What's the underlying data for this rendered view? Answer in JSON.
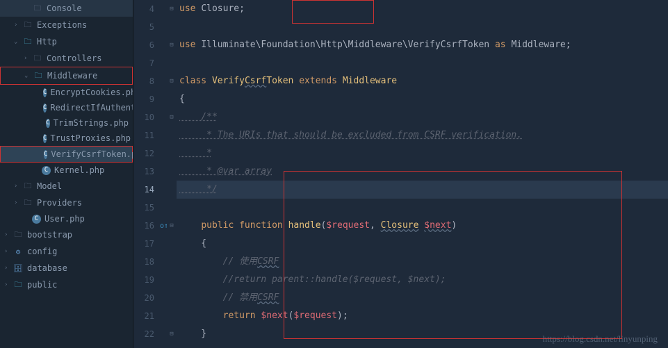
{
  "sidebar": {
    "items": [
      {
        "chevron": "",
        "icon": "folder-dark",
        "iconGlyph": "🗀",
        "label": "Console",
        "depth": 2,
        "interactable": true
      },
      {
        "chevron": "›",
        "icon": "folder-dark",
        "iconGlyph": "🗀",
        "label": "Exceptions",
        "depth": 1,
        "interactable": true
      },
      {
        "chevron": "⌄",
        "icon": "folder",
        "iconGlyph": "🗀",
        "label": "Http",
        "depth": 1,
        "interactable": true
      },
      {
        "chevron": "›",
        "icon": "folder-dark",
        "iconGlyph": "🗀",
        "label": "Controllers",
        "depth": 2,
        "interactable": true
      },
      {
        "chevron": "⌄",
        "icon": "folder",
        "iconGlyph": "🗀",
        "label": "Middleware",
        "depth": 2,
        "interactable": true,
        "redBox": 1
      },
      {
        "chevron": "",
        "icon": "php-class",
        "iconGlyph": "C",
        "label": "EncryptCookies.php",
        "depth": 4,
        "interactable": true
      },
      {
        "chevron": "",
        "icon": "php-class",
        "iconGlyph": "C",
        "label": "RedirectIfAuthenticated.php",
        "depth": 4,
        "interactable": true
      },
      {
        "chevron": "",
        "icon": "php-class",
        "iconGlyph": "C",
        "label": "TrimStrings.php",
        "depth": 4,
        "interactable": true
      },
      {
        "chevron": "",
        "icon": "php-class",
        "iconGlyph": "C",
        "label": "TrustProxies.php",
        "depth": 4,
        "interactable": true
      },
      {
        "chevron": "",
        "icon": "php-class",
        "iconGlyph": "C",
        "label": "VerifyCsrfToken.php",
        "depth": 4,
        "interactable": true,
        "selected": true,
        "redBox": 2
      },
      {
        "chevron": "",
        "icon": "php-class",
        "iconGlyph": "C",
        "label": "Kernel.php",
        "depth": 3,
        "interactable": true
      },
      {
        "chevron": "›",
        "icon": "folder-dark",
        "iconGlyph": "🗀",
        "label": "Model",
        "depth": 1,
        "interactable": true
      },
      {
        "chevron": "›",
        "icon": "folder-dark",
        "iconGlyph": "🗀",
        "label": "Providers",
        "depth": 1,
        "interactable": true
      },
      {
        "chevron": "",
        "icon": "php-class",
        "iconGlyph": "C",
        "label": "User.php",
        "depth": 2,
        "interactable": true
      },
      {
        "chevron": "›",
        "icon": "folder-dark",
        "iconGlyph": "🗀",
        "label": "bootstrap",
        "depth": 0,
        "interactable": true
      },
      {
        "chevron": "›",
        "icon": "special",
        "iconGlyph": "⚙",
        "label": "config",
        "depth": 0,
        "interactable": true
      },
      {
        "chevron": "›",
        "icon": "special",
        "iconGlyph": "🗄",
        "label": "database",
        "depth": 0,
        "interactable": true
      },
      {
        "chevron": "›",
        "icon": "folder",
        "iconGlyph": "🗀",
        "label": "public",
        "depth": 0,
        "interactable": true
      }
    ]
  },
  "editor": {
    "lines": [
      {
        "num": 4,
        "fold": "⊟",
        "segments": [
          {
            "cls": "kw-orange",
            "text": "use "
          },
          {
            "cls": "ns",
            "text": "Closure"
          },
          {
            "cls": "punct",
            "text": ";"
          }
        ]
      },
      {
        "num": 5,
        "fold": "",
        "segments": []
      },
      {
        "num": 6,
        "fold": "⊟",
        "segments": [
          {
            "cls": "kw-orange",
            "text": "use "
          },
          {
            "cls": "ns",
            "text": "Illuminate\\Foundation\\Http\\Middleware\\VerifyCsrfToken"
          },
          {
            "cls": "kw-orange",
            "text": " as "
          },
          {
            "cls": "ns",
            "text": "Middleware"
          },
          {
            "cls": "punct",
            "text": ";"
          }
        ]
      },
      {
        "num": 7,
        "fold": "",
        "segments": []
      },
      {
        "num": 8,
        "fold": "⊟",
        "segments": [
          {
            "cls": "kw-orange",
            "text": "class "
          },
          {
            "cls": "cls",
            "text": "Verify"
          },
          {
            "cls": "cls underline-wavy",
            "text": "Csrf"
          },
          {
            "cls": "cls",
            "text": "Token "
          },
          {
            "cls": "kw-orange",
            "text": "extends "
          },
          {
            "cls": "cls",
            "text": "Middleware"
          }
        ]
      },
      {
        "num": 9,
        "fold": "",
        "segments": [
          {
            "cls": "punct",
            "text": "{"
          }
        ]
      },
      {
        "num": 10,
        "fold": "⊟",
        "segments": [
          {
            "cls": "doc",
            "text": "    /**"
          }
        ]
      },
      {
        "num": 11,
        "fold": "",
        "segments": [
          {
            "cls": "doc",
            "text": "     * The URIs that should be excluded from CSRF verification."
          }
        ]
      },
      {
        "num": 12,
        "fold": "",
        "segments": [
          {
            "cls": "doc",
            "text": "     *"
          }
        ]
      },
      {
        "num": 13,
        "fold": "",
        "segments": [
          {
            "cls": "doc",
            "text": "     * @var array"
          }
        ]
      },
      {
        "num": 14,
        "fold": "",
        "current": true,
        "segments": [
          {
            "cls": "doc",
            "text": "     */"
          }
        ]
      },
      {
        "num": 15,
        "fold": "",
        "segments": []
      },
      {
        "num": 16,
        "fold": "⊟",
        "marker": "o↑",
        "segments": [
          {
            "cls": "",
            "text": "    "
          },
          {
            "cls": "kw-orange",
            "text": "public "
          },
          {
            "cls": "kw-orange",
            "text": "function "
          },
          {
            "cls": "fn",
            "text": "handle"
          },
          {
            "cls": "punct",
            "text": "("
          },
          {
            "cls": "var",
            "text": "$request"
          },
          {
            "cls": "punct",
            "text": ", "
          },
          {
            "cls": "cls underline-wavy",
            "text": "Closure"
          },
          {
            "cls": "",
            "text": " "
          },
          {
            "cls": "var underline-wavy",
            "text": "$next"
          },
          {
            "cls": "punct",
            "text": ")"
          }
        ]
      },
      {
        "num": 17,
        "fold": "",
        "segments": [
          {
            "cls": "punct",
            "text": "    {"
          }
        ]
      },
      {
        "num": 18,
        "fold": "",
        "segments": [
          {
            "cls": "com",
            "text": "        // 使用"
          },
          {
            "cls": "com underline-wavy",
            "text": "CSRF"
          }
        ]
      },
      {
        "num": 19,
        "fold": "",
        "segments": [
          {
            "cls": "com",
            "text": "        //return parent::handle($request, $next);"
          }
        ]
      },
      {
        "num": 20,
        "fold": "",
        "segments": [
          {
            "cls": "com",
            "text": "        // 禁用"
          },
          {
            "cls": "com underline-wavy",
            "text": "CSRF"
          }
        ]
      },
      {
        "num": 21,
        "fold": "",
        "segments": [
          {
            "cls": "",
            "text": "        "
          },
          {
            "cls": "kw-orange",
            "text": "return "
          },
          {
            "cls": "var",
            "text": "$next"
          },
          {
            "cls": "punct",
            "text": "("
          },
          {
            "cls": "var",
            "text": "$request"
          },
          {
            "cls": "punct",
            "text": ");"
          }
        ]
      },
      {
        "num": 22,
        "fold": "⊟",
        "segments": [
          {
            "cls": "punct",
            "text": "    }"
          }
        ]
      }
    ]
  },
  "watermark": "https://blog.csdn.net/linyunping"
}
